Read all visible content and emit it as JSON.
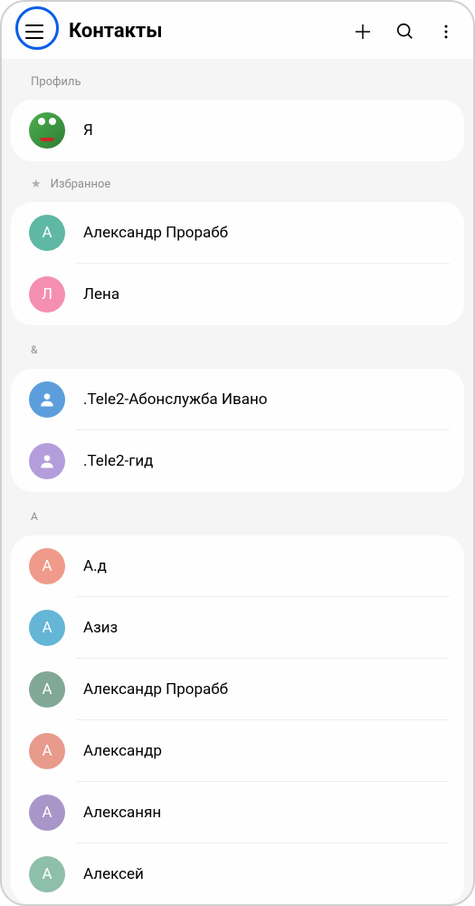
{
  "header": {
    "title": "Контакты"
  },
  "sections": {
    "profile_label": "Профиль",
    "favorites_label": "Избранное",
    "amp_label": "&",
    "a_label": "А"
  },
  "profile": {
    "name": "Я"
  },
  "favorites": [
    {
      "name": "Александр Прорабб",
      "initial": "А",
      "color": "avatar-teal"
    },
    {
      "name": "Лена",
      "initial": "Л",
      "color": "avatar-pink"
    }
  ],
  "amp_group": [
    {
      "name": ".Tele2-Абонслужба Ивано",
      "icon": "person",
      "color": "avatar-blue"
    },
    {
      "name": ".Tele2-гид",
      "icon": "person",
      "color": "avatar-purple"
    }
  ],
  "a_group": [
    {
      "name": "А.д",
      "initial": "А",
      "color": "avatar-coral"
    },
    {
      "name": "Азиз",
      "initial": "А",
      "color": "avatar-skyblue"
    },
    {
      "name": "Александр Прорабб",
      "initial": "А",
      "color": "avatar-sage"
    },
    {
      "name": "Александр",
      "initial": "А",
      "color": "avatar-salmon"
    },
    {
      "name": "Алексанян",
      "initial": "А",
      "color": "avatar-lavender"
    },
    {
      "name": "Алексей",
      "initial": "А",
      "color": "avatar-mint"
    }
  ]
}
